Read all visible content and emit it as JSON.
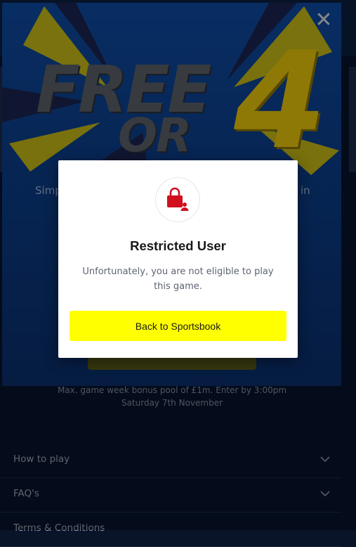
{
  "promo": {
    "hero_free": "FREE",
    "hero_or": "OR",
    "hero_four": "4",
    "desc_left": "Simp",
    "desc_right": "in",
    "close_glyph": "✕",
    "note": "Max. game week bonus pool of £1m. Enter by 3:00pm Saturday 7th November"
  },
  "accordion": [
    {
      "label": "How to play"
    },
    {
      "label": "FAQ's"
    },
    {
      "label": "Terms & Conditions"
    }
  ],
  "dialog": {
    "icon": "lock-user-icon",
    "title": "Restricted User",
    "message": "Unfortunately, you are not eligible to play this game.",
    "button_label": "Back to Sportsbook"
  },
  "colors": {
    "accent": "#ffff00",
    "lock": "#d0101d"
  }
}
